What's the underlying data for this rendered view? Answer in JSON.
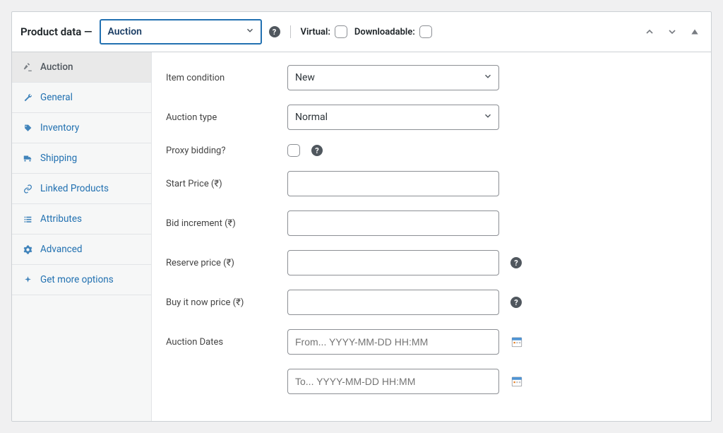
{
  "panel": {
    "title_prefix": "Product data —",
    "product_type": "Auction",
    "virtual_label": "Virtual:",
    "downloadable_label": "Downloadable:"
  },
  "tabs": [
    {
      "label": "Auction"
    },
    {
      "label": "General"
    },
    {
      "label": "Inventory"
    },
    {
      "label": "Shipping"
    },
    {
      "label": "Linked Products"
    },
    {
      "label": "Attributes"
    },
    {
      "label": "Advanced"
    },
    {
      "label": "Get more options"
    }
  ],
  "fields": {
    "item_condition_label": "Item condition",
    "item_condition_value": "New",
    "auction_type_label": "Auction type",
    "auction_type_value": "Normal",
    "proxy_bidding_label": "Proxy bidding?",
    "start_price_label": "Start Price (₹)",
    "bid_increment_label": "Bid increment (₹)",
    "reserve_price_label": "Reserve price (₹)",
    "buy_now_label": "Buy it now price (₹)",
    "auction_dates_label": "Auction Dates",
    "date_from_placeholder": "From... YYYY-MM-DD HH:MM",
    "date_to_placeholder": "To... YYYY-MM-DD HH:MM"
  }
}
